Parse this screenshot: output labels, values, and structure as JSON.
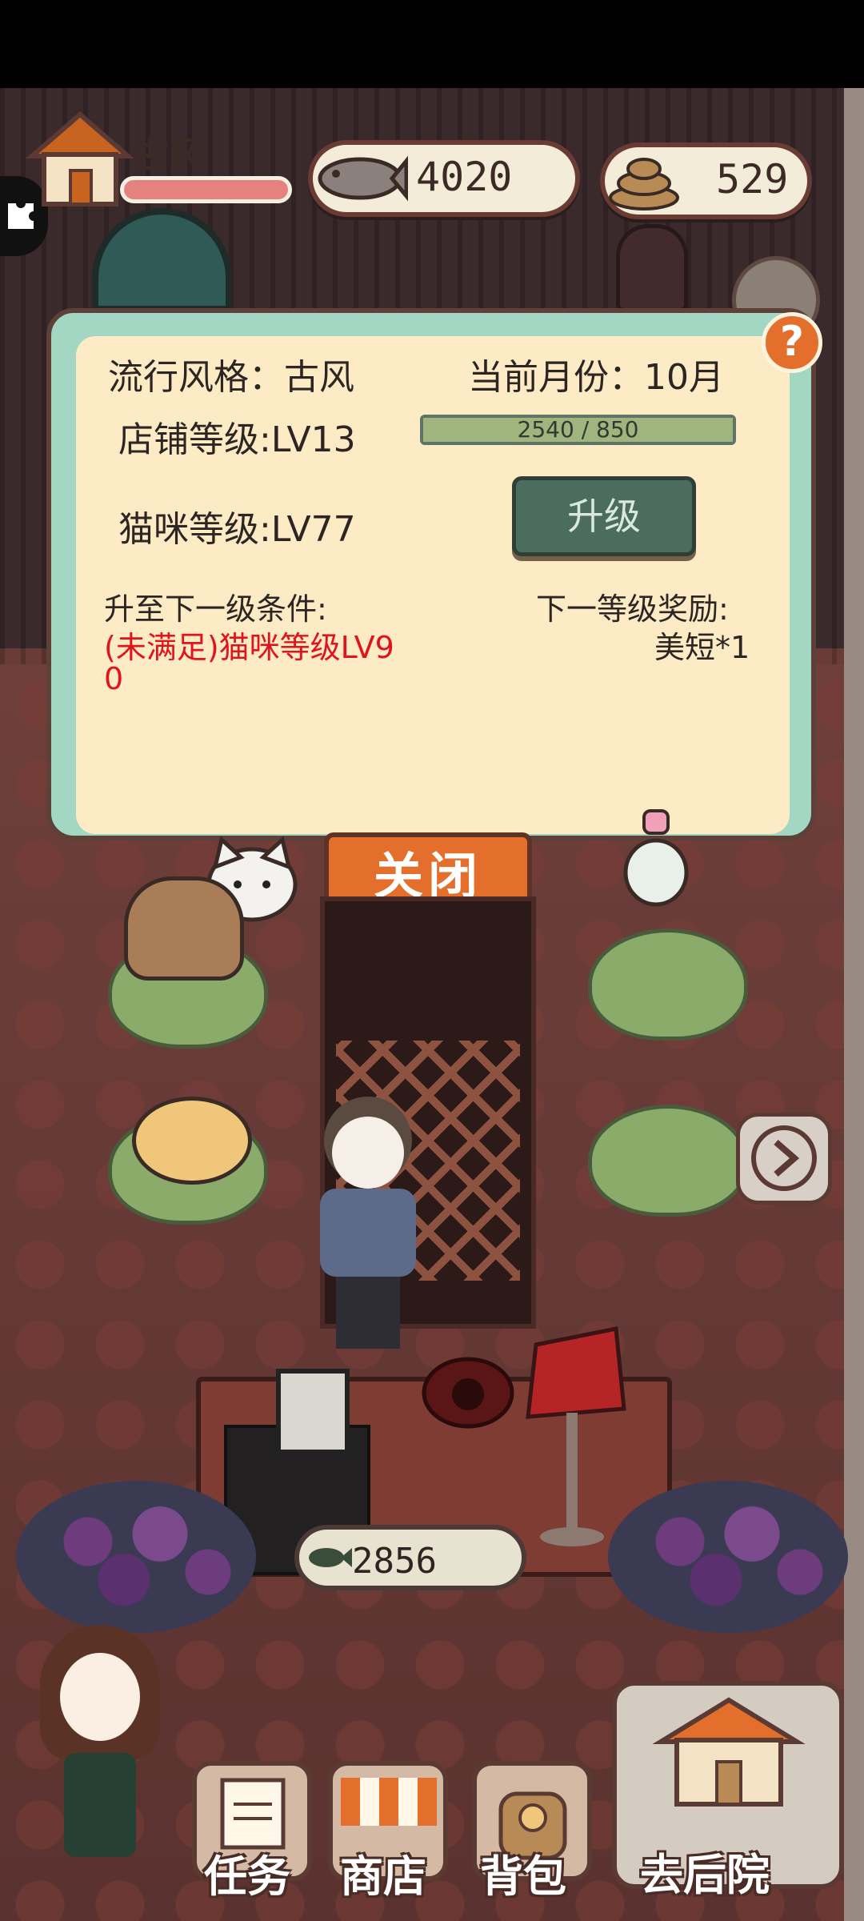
{
  "header": {
    "style_name": "古风",
    "fish_count": "4020",
    "poop_count": "529"
  },
  "panel": {
    "popular_style": "流行风格：古风",
    "current_month": "当前月份：10月",
    "shop_level": "店铺等级:LV13",
    "xp_text": "2540 / 850",
    "cat_level": "猫咪等级:LV77",
    "upgrade_label": "升级",
    "next_condition_title": "升至下一级条件:",
    "condition_line1": "(未满足)猫咪等级LV9",
    "condition_line2": "0",
    "next_reward_title": "下一等级奖励:",
    "reward_item": "美短*1",
    "help_label": "?"
  },
  "close_label": "关闭",
  "counter_fish": "2856",
  "nav": {
    "task": "任务",
    "shop": "商店",
    "bag": "背包",
    "backyard": "去后院"
  },
  "colors": {
    "panel_frame": "#a3d7c4",
    "panel_bg": "#fdebc6",
    "accent_orange": "#e46f2c",
    "warning_red": "#e0141c",
    "upgrade_green": "#4b6c5f"
  }
}
